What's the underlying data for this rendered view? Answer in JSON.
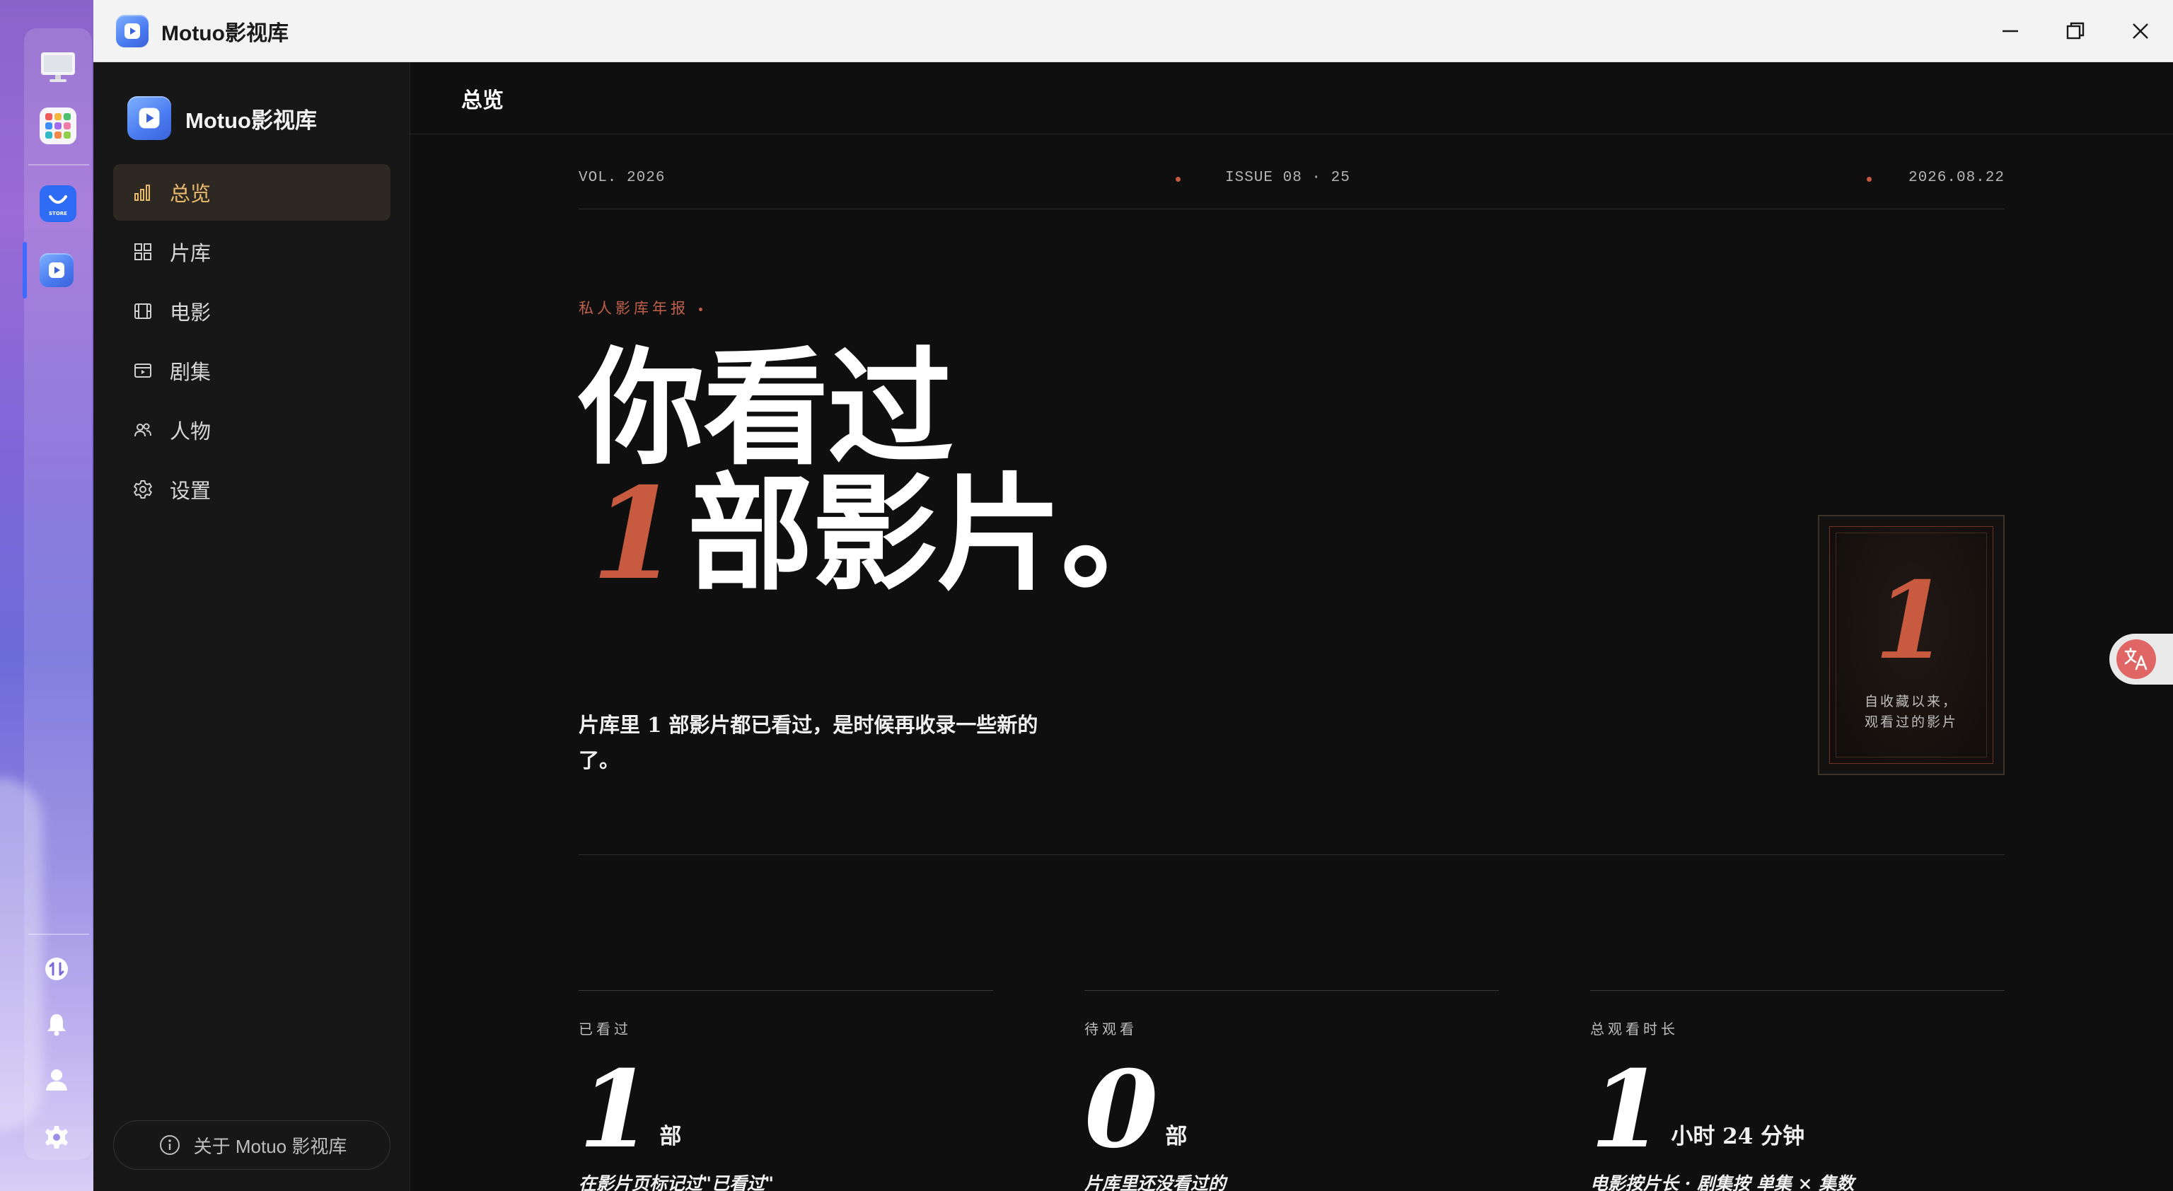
{
  "window": {
    "title": "Motuo影视库",
    "controls": {
      "minimize_icon": "minimize-icon",
      "maximize_icon": "maximize-icon",
      "close_icon": "close-icon"
    }
  },
  "dock": {
    "items": [
      "monitor-icon",
      "apps-grid-icon",
      "store-icon",
      "motuo-app-icon"
    ],
    "store_label": "STORE",
    "bottom_items": [
      "update-icon",
      "bell-icon",
      "user-icon",
      "gear-icon"
    ]
  },
  "sidebar": {
    "brand": "Motuo影视库",
    "items": [
      {
        "label": "总览",
        "icon": "bar-chart-icon",
        "active": true
      },
      {
        "label": "片库",
        "icon": "grid-icon"
      },
      {
        "label": "电影",
        "icon": "film-icon"
      },
      {
        "label": "剧集",
        "icon": "tv-series-icon"
      },
      {
        "label": "人物",
        "icon": "people-icon"
      },
      {
        "label": "设置",
        "icon": "gear-icon"
      }
    ],
    "about": "关于 Motuo 影视库"
  },
  "main": {
    "page_title": "总览",
    "meta": {
      "vol": "VOL. 2026",
      "issue": "ISSUE 08 · 25",
      "date": "2026.08.22"
    },
    "kicker": "私人影库年报",
    "headline": {
      "line1": "你看过",
      "number": "1",
      "line2": "部影片。"
    },
    "subline": "片库里 1 部影片都已看过，是时候再收录一些新的了。",
    "ticket": {
      "number": "1",
      "caption_line1": "自收藏以来，",
      "caption_line2": "观看过的影片"
    },
    "stats": [
      {
        "label": "已看过",
        "value": "1",
        "unit": "部",
        "note": "在影片页标记过\"已看过\""
      },
      {
        "label": "待观看",
        "value": "0",
        "unit": "部",
        "note": "片库里还没看过的"
      },
      {
        "label": "总观看时长",
        "value": "1",
        "unit": "小时 24 分钟",
        "note": "电影按片长 · 剧集按 单集 × 集数"
      }
    ]
  },
  "colors": {
    "accent": "#c85a40",
    "nav_active_text": "#e9b96c",
    "nav_active_bg": "#2d2822",
    "background": "#0f0f0f",
    "sidebar_bg": "#171717"
  }
}
